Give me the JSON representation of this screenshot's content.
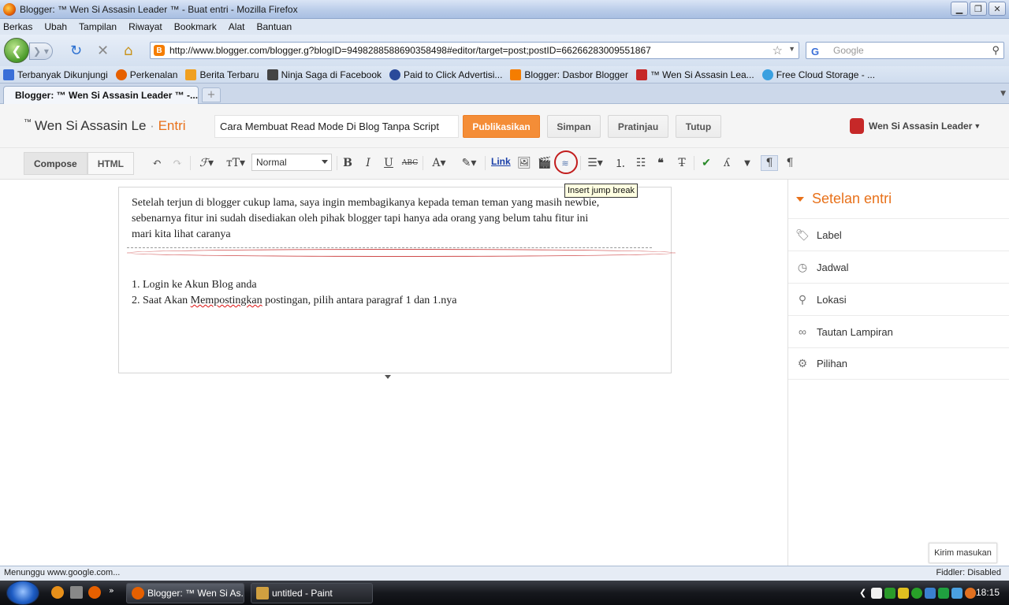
{
  "window": {
    "title": "Blogger: ™ Wen Si Assasin Leader ™ - Buat entri - Mozilla Firefox"
  },
  "menu": [
    "Berkas",
    "Ubah",
    "Tampilan",
    "Riwayat",
    "Bookmark",
    "Alat",
    "Bantuan"
  ],
  "nav": {
    "url": "http://www.blogger.com/blogger.g?blogID=9498288588690358498#editor/target=post;postID=6626628300955186​7",
    "search_placeholder": "Google"
  },
  "bookmarks": [
    {
      "label": "Terbanyak Dikunjungi",
      "color": "#3a6fd8"
    },
    {
      "label": "Perkenalan",
      "color": "#e66000"
    },
    {
      "label": "Berita Terbaru",
      "color": "#f0a020"
    },
    {
      "label": "Ninja Saga di Facebook",
      "color": "#444444"
    },
    {
      "label": "Paid to Click Advertisi...",
      "color": "#2a4a9a"
    },
    {
      "label": "Blogger: Dasbor Blogger",
      "color": "#f57d00"
    },
    {
      "label": "™ Wen Si Assasin Lea...",
      "color": "#c62828"
    },
    {
      "label": "Free Cloud Storage - ...",
      "color": "#3aa0e0"
    }
  ],
  "tab": {
    "label": "Blogger: ™ Wen Si Assasin Leader ™ -..."
  },
  "blogger": {
    "tm": "™",
    "blog_name": "Wen Si Assasin Le",
    "separator": "·",
    "section": "Entri",
    "post_title": "Cara Membuat Read Mode Di Blog Tanpa Script",
    "publish_label": "Publikasikan",
    "save_label": "Simpan",
    "preview_label": "Pratinjau",
    "close_label": "Tutup",
    "account_name": "Wen Si Assasin Leader"
  },
  "toolbar": {
    "compose_label": "Compose",
    "html_label": "HTML",
    "font_size_value": "Normal",
    "bold": "B",
    "italic": "I",
    "underline": "U",
    "strike": "ABC",
    "link_label": "Link",
    "tooltip": "Insert jump break"
  },
  "editor": {
    "line1": "Setelah terjun di blogger cukup lama, saya ingin membagikanya kepada teman teman yang masih newbie,",
    "line2": "sebenarnya fitur ini sudah disediakan oleh pihak blogger tapi hanya ada orang yang belum tahu fitur ini",
    "line3": "mari kita lihat caranya",
    "item1": "1. Login ke Akun Blog anda",
    "item2_pre": "2. Saat Akan ",
    "item2_word": "Mempostingkan",
    "item2_post": " postingan, pilih antara paragraf 1 dan 1.nya"
  },
  "sidebar": {
    "heading": "Setelan entri",
    "items": [
      "Label",
      "Jadwal",
      "Lokasi",
      "Tautan Lampiran",
      "Pilihan"
    ],
    "feedback": "Kirim masukan"
  },
  "status": {
    "left": "Menunggu www.google.com...",
    "right": "Fiddler: Disabled"
  },
  "taskbar": {
    "item1": "Blogger: ™ Wen Si As...",
    "item2": "untitled - Paint",
    "clock": "18:15"
  }
}
